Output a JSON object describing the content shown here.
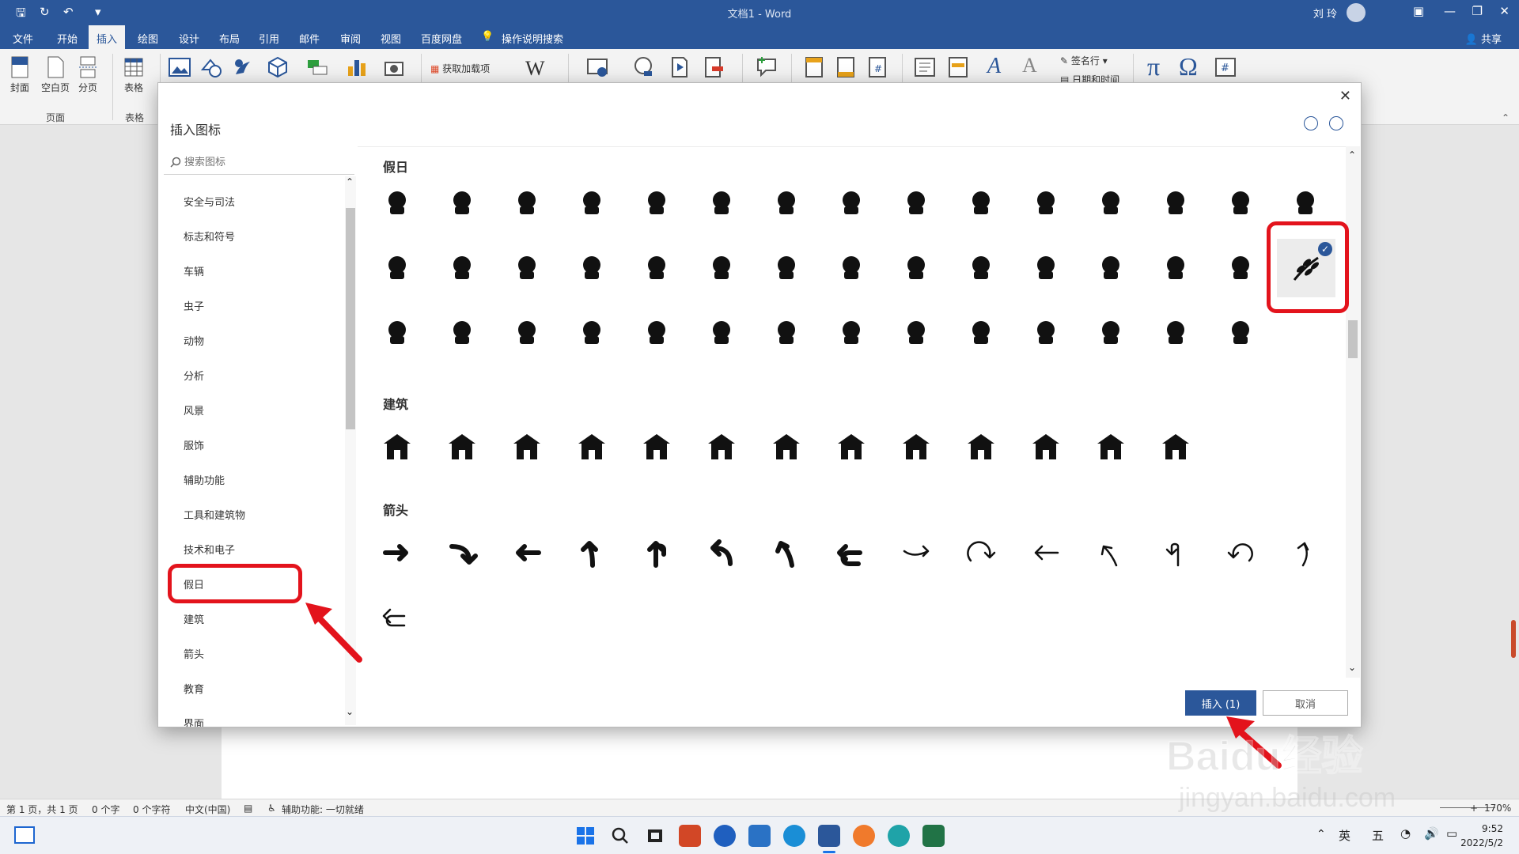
{
  "app": {
    "title": "文档1  -  Word",
    "user_name": "刘 玲",
    "share_label": "共享"
  },
  "tabs": [
    "文件",
    "开始",
    "插入",
    "绘图",
    "设计",
    "布局",
    "引用",
    "邮件",
    "审阅",
    "视图",
    "百度网盘",
    "操作说明搜索"
  ],
  "active_tab": "插入",
  "ribbon": {
    "page_buttons": [
      "封面",
      "空白页",
      "分页"
    ],
    "page_group": "页面",
    "table_button": "表格",
    "table_group": "表格",
    "addins_label": "获取加载项",
    "signature_label": "签名行",
    "datetime_label": "日期和时间"
  },
  "dialog": {
    "title": "插入图标",
    "search_placeholder": "搜索图标",
    "categories": [
      "安全与司法",
      "标志和符号",
      "车辆",
      "虫子",
      "动物",
      "分析",
      "风景",
      "服饰",
      "辅助功能",
      "工具和建筑物",
      "技术和电子",
      "假日",
      "建筑",
      "箭头",
      "教育",
      "界面"
    ],
    "selected_category": "假日",
    "sections": [
      {
        "title": "假日",
        "icons": [
          "champagne-glasses",
          "masquerade-mask",
          "jester-hat",
          "dragon-dancer",
          "wind-chime",
          "firecracker-bundle",
          "chinese-lantern",
          "fortune-cookie",
          "folding-fan",
          "birthday-cake",
          "lock-heart",
          "heart-stamp",
          "horseshoe",
          "shamrock",
          "leprechaun-hat",
          "pot-of-gold",
          "rainbow",
          "easter-bunny",
          "chick",
          "easter-basket",
          "carp-streamer",
          "sparkler",
          "firework-rocket",
          "fireworks",
          "witch-hat-broom",
          "haunted-house",
          "spider-web",
          "skull",
          "tombstone",
          "olive-branch",
          "acorn",
          "corn",
          "pumpkin",
          "turkey",
          "cornucopia",
          "roast-turkey",
          "candelabra",
          "bow",
          "bells",
          "stocking",
          "wreath",
          "christmas-tree",
          "candy-cane",
          "gingerbread-man"
        ]
      },
      {
        "title": "建筑",
        "icons": [
          "city",
          "office-building",
          "factory",
          "house",
          "house-2",
          "museum",
          "government",
          "store",
          "shop",
          "school",
          "barn",
          "phone-booth",
          "windmill"
        ]
      },
      {
        "title": "箭头",
        "icons": [
          "arrow-right",
          "arrow-curve-down",
          "arrow-left",
          "arrow-up-curve",
          "arrow-u-turn",
          "arrow-curve-left",
          "arrow-up-left",
          "arrow-return",
          "line-arrow-right",
          "line-arrow-circle",
          "line-arrow-left",
          "line-arrow-up-left",
          "line-arrow-u-turn",
          "line-arrow-ccw",
          "line-arrow-up",
          "line-arrow-return"
        ]
      }
    ],
    "selected_icon": "olive-branch",
    "insert_label": "插入 (1)",
    "cancel_label": "取消"
  },
  "status": {
    "page": "第 1 页，共 1 页",
    "words": "0 个字",
    "chars": "0 个字符",
    "language": "中文(中国)",
    "accessibility": "辅助功能: 一切就绪",
    "zoom": "170%"
  },
  "taskbar": {
    "lang": "英",
    "ime": "五",
    "time": "9:52",
    "date": "2022/5/2"
  },
  "watermark": {
    "text": "Baidu经验",
    "url": "jingyan.baidu.com"
  },
  "colors": {
    "word_blue": "#2b579a",
    "annotation_red": "#e3131c"
  }
}
